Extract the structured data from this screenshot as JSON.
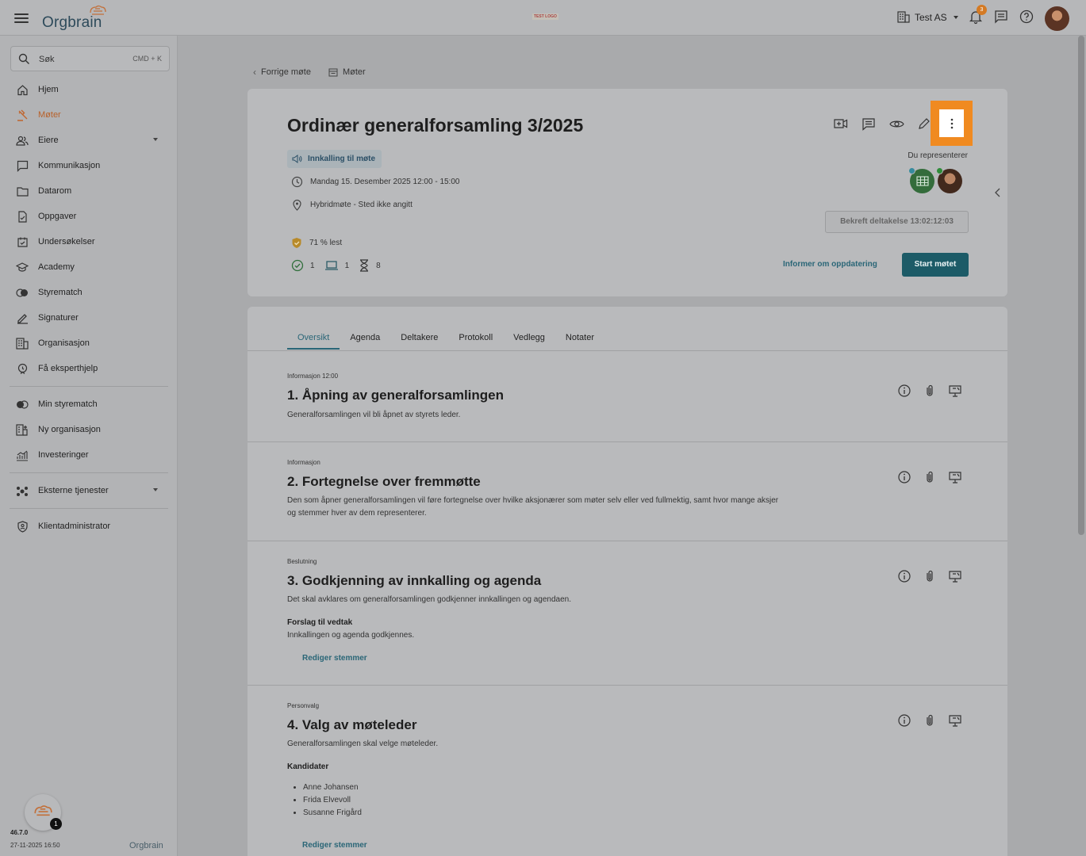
{
  "header": {
    "logo_text": "Orgbrain",
    "test_logo": "TEST LOGO",
    "org_name": "Test AS",
    "notification_count": "3"
  },
  "sidebar": {
    "search_placeholder": "Søk",
    "search_shortcut": "CMD + K",
    "items": [
      {
        "label": "Hjem",
        "icon": "home-icon"
      },
      {
        "label": "Møter",
        "icon": "gavel-icon",
        "active": true
      },
      {
        "label": "Eiere",
        "icon": "people-icon",
        "has_caret": true
      },
      {
        "label": "Kommunikasjon",
        "icon": "chat-icon"
      },
      {
        "label": "Datarom",
        "icon": "folder-icon"
      },
      {
        "label": "Oppgaver",
        "icon": "task-icon"
      },
      {
        "label": "Undersøkelser",
        "icon": "survey-icon"
      },
      {
        "label": "Academy",
        "icon": "academy-icon"
      },
      {
        "label": "Styrematch",
        "icon": "match-icon"
      },
      {
        "label": "Signaturer",
        "icon": "signature-icon"
      },
      {
        "label": "Organisasjon",
        "icon": "building-icon"
      },
      {
        "label": "Få eksperthjelp",
        "icon": "expert-icon"
      }
    ],
    "items2": [
      {
        "label": "Min styrematch",
        "icon": "match-icon"
      },
      {
        "label": "Ny organisasjon",
        "icon": "new-org-icon"
      },
      {
        "label": "Investeringer",
        "icon": "chart-icon"
      }
    ],
    "items3": [
      {
        "label": "Eksterne tjenester",
        "icon": "services-icon",
        "has_caret": true
      }
    ],
    "items4": [
      {
        "label": "Klientadministrator",
        "icon": "shield-icon"
      }
    ],
    "help_badge": "1",
    "version": "46.7.0",
    "build_date": "27-11-2025 16:50",
    "footer_logo": "Orgbrain"
  },
  "breadcrumb": {
    "previous": "Forrige møte",
    "meetings": "Møter"
  },
  "meeting": {
    "title": "Ordinær generalforsamling 3/2025",
    "status": "Innkalling til møte",
    "datetime": "Mandag 15. Desember 2025 12:00 - 15:00",
    "location": "Hybridmøte - Sted ikke angitt",
    "read_percent": "71 % lest",
    "count_accepted": "1",
    "count_digital": "1",
    "count_pending": "8",
    "represent_label": "Du representerer",
    "confirm_button": "Bekreft deltakelse 13:02:12:03",
    "inform_link": "Informer om oppdatering",
    "start_button": "Start møtet"
  },
  "tabs": [
    "Oversikt",
    "Agenda",
    "Deltakere",
    "Protokoll",
    "Vedlegg",
    "Notater"
  ],
  "agenda": [
    {
      "type": "Informasjon 12:00",
      "title": "1. Åpning av generalforsamlingen",
      "desc": "Generalforsamlingen vil bli åpnet av styrets leder."
    },
    {
      "type": "Informasjon",
      "title": "2. Fortegnelse over fremmøtte",
      "desc": "Den som åpner generalforsamlingen vil føre fortegnelse over hvilke aksjonærer som møter selv eller ved fullmektig, samt hvor mange aksjer og stemmer hver av dem representerer."
    },
    {
      "type": "Beslutning",
      "title": "3. Godkjenning av innkalling og agenda",
      "desc": "Det skal avklares om generalforsamlingen godkjenner innkallingen og agendaen.",
      "sub_title": "Forslag til vedtak",
      "sub_text": "Innkallingen og agenda godkjennes.",
      "link": "Rediger stemmer"
    },
    {
      "type": "Personvalg",
      "title": "4. Valg av møteleder",
      "desc": "Generalforsamlingen skal velge møteleder.",
      "sub_title": "Kandidater",
      "candidates": [
        "Anne Johansen",
        "Frida Elvevoll",
        "Susanne Frigård"
      ],
      "link": "Rediger stemmer"
    }
  ],
  "colors": {
    "accent_teal": "#2a6677",
    "brand_orange": "#f08a20",
    "start_button": "#1c5b67"
  }
}
